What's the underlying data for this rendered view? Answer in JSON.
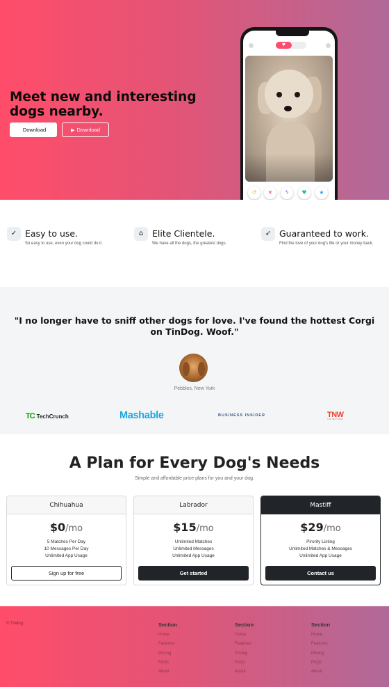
{
  "hero": {
    "title": "Meet new and interesting dogs nearby.",
    "download_apple": "Download",
    "download_play": "Download",
    "apple_icon": "apple-icon",
    "play_icon": "google-play-icon"
  },
  "features": [
    {
      "icon": "check-circle-icon",
      "glyph": "✓",
      "title": "Easy to use.",
      "desc": "So easy to use, even your dog could do it."
    },
    {
      "icon": "graduation-cap-icon",
      "glyph": "🎓",
      "title": "Elite Clientele.",
      "desc": "We have all the dogs, the greatest dogs."
    },
    {
      "icon": "heart-arrow-icon",
      "glyph": "➶",
      "title": "Guaranteed to work.",
      "desc": "Find the love of your dog's life or your money back."
    }
  ],
  "testimonial": {
    "quote": "\"I no longer have to sniff other dogs for love. I've found the hottest Corgi on TinDog. Woof.\"",
    "author": "Pebbles, New York"
  },
  "press": {
    "techcrunch_mark": "TC",
    "techcrunch": "TechCrunch",
    "mashable": "Mashable",
    "business_insider": "BUSINESS INSIDER",
    "tnw": "TNW",
    "tnw_sub": "THE NEXT WEB"
  },
  "pricing": {
    "title": "A Plan for Every Dog's Needs",
    "subtitle": "Simple and affordable price plans for you and your dog.",
    "plans": [
      {
        "name": "Chihuahua",
        "price": "$0",
        "per": "/mo",
        "features": [
          "5 Matches Per Day",
          "10 Messages Per Day",
          "Unlimited App Usage"
        ],
        "button": "Sign up for free"
      },
      {
        "name": "Labrador",
        "price": "$15",
        "per": "/mo",
        "features": [
          "Unlimited Matches",
          "Unlimited Messages",
          "Unlimited App Usage"
        ],
        "button": "Get started"
      },
      {
        "name": "Mastiff",
        "price": "$29",
        "per": "/mo",
        "features": [
          "Pirority Listing",
          "Unlimited Matches & Messages",
          "Unlimited App Usage"
        ],
        "button": "Contact us"
      }
    ]
  },
  "footer": {
    "copyright": "© Tindog",
    "columns": [
      {
        "heading": "Section",
        "links": [
          "Home",
          "Features",
          "Pricing",
          "FAQs",
          "About"
        ]
      },
      {
        "heading": "Section",
        "links": [
          "Home",
          "Features",
          "Pricing",
          "FAQs",
          "About"
        ]
      },
      {
        "heading": "Section",
        "links": [
          "Home",
          "Features",
          "Pricing",
          "FAQs",
          "About"
        ]
      }
    ]
  },
  "colors": {
    "gradient_start": "#ff4d6a",
    "gradient_end": "#b06a99",
    "dark": "#212529",
    "light_bg": "#f4f5f7"
  }
}
